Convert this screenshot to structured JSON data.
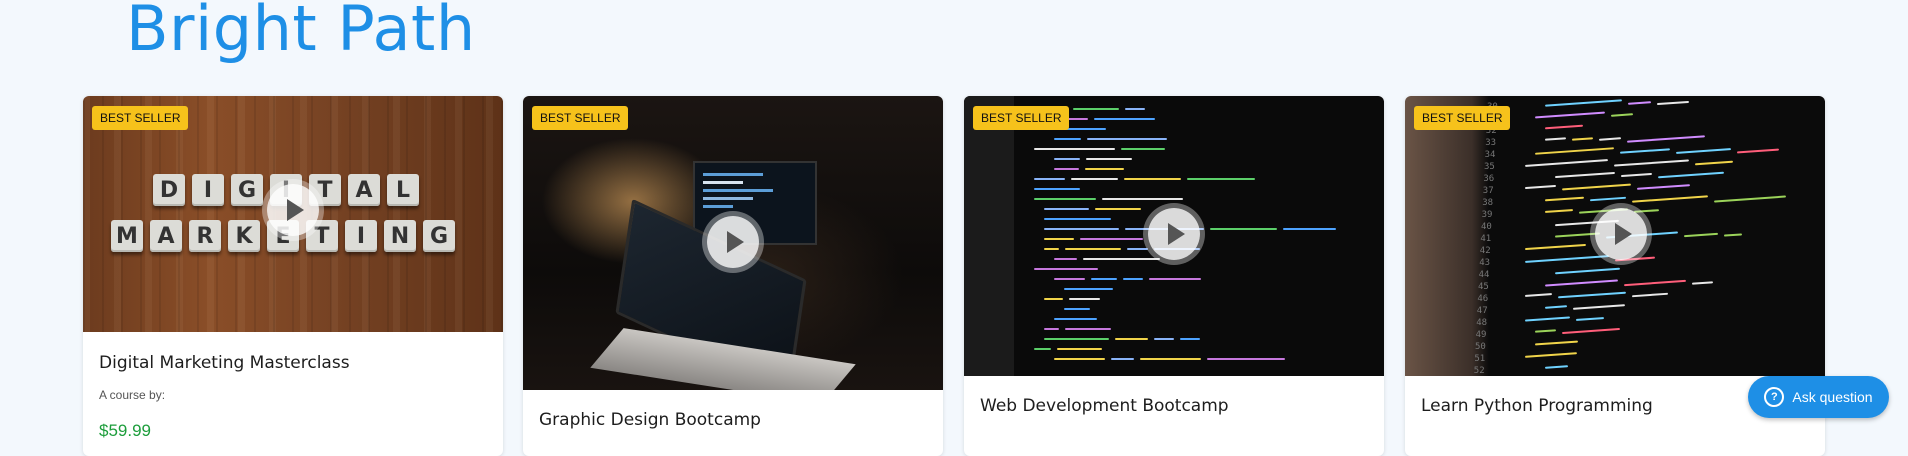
{
  "header": {
    "brand": "Bright Path"
  },
  "cards": [
    {
      "badge": "BEST SELLER",
      "title": "Digital Marketing Masterclass",
      "byline": "A course by:",
      "price": "$59.99",
      "thumb": "digital-marketing-tiles"
    },
    {
      "badge": "BEST SELLER",
      "title": "Graphic Design Bootcamp",
      "thumb": "laptop-dark-desk"
    },
    {
      "badge": "BEST SELLER",
      "title": "Web Development Bootcamp",
      "thumb": "code-editor"
    },
    {
      "badge": "BEST SELLER",
      "title": "Learn Python Programming",
      "thumb": "python-code"
    }
  ],
  "tiles": {
    "row1": [
      "D",
      "I",
      "G",
      "I",
      "T",
      "A",
      "L"
    ],
    "row2": [
      "M",
      "A",
      "R",
      "K",
      "E",
      "T",
      "I",
      "N",
      "G"
    ]
  },
  "ask": {
    "label": "Ask question",
    "icon": "question-circle-icon"
  },
  "colors": {
    "brand": "#1e8fe6",
    "badge": "#f6c21b",
    "price": "#1c9d3b",
    "background": "#f3f8fd"
  }
}
